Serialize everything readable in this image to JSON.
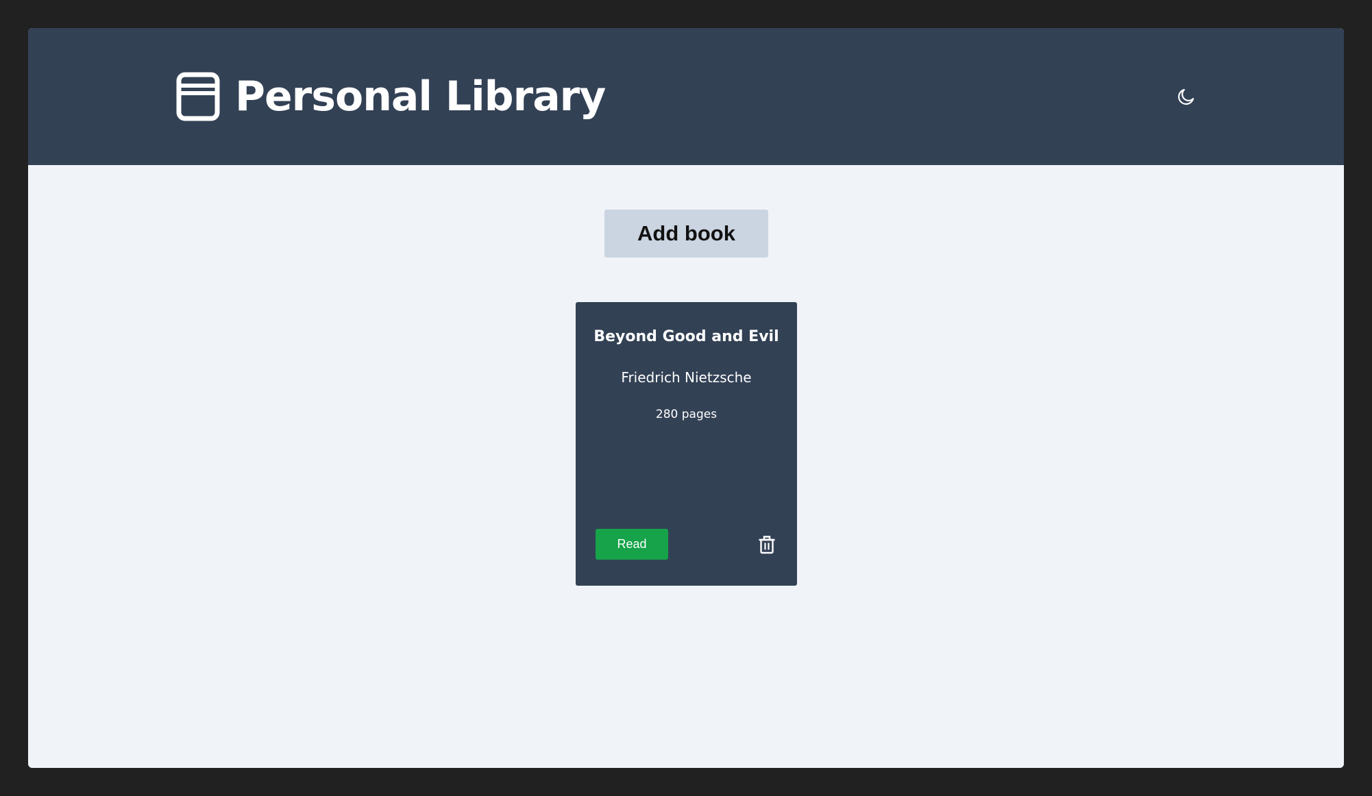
{
  "header": {
    "title": "Personal Library",
    "logo_icon": "book-icon",
    "theme_toggle_icon": "moon-icon",
    "background_color": "#334155"
  },
  "main": {
    "add_book_label": "Add book",
    "background_color": "#f0f3f8"
  },
  "books": [
    {
      "title": "Beyond Good and Evil",
      "author": "Friedrich Nietzsche",
      "pages": "280 pages",
      "status_label": "Read",
      "status_color": "#16a34a",
      "delete_icon": "trash-icon"
    }
  ]
}
